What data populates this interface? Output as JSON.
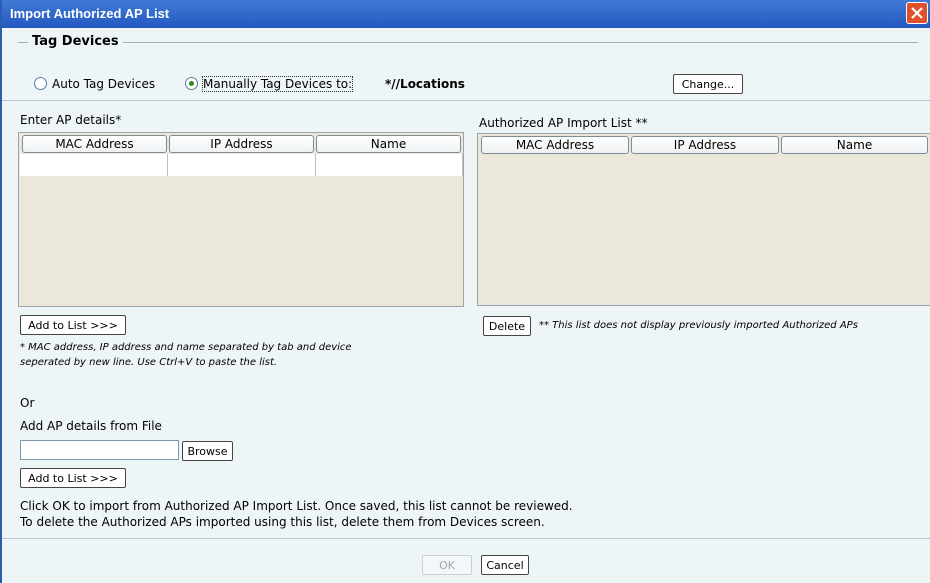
{
  "window": {
    "title": "Import Authorized AP List"
  },
  "tag_devices": {
    "legend": "Tag Devices",
    "auto_label": "Auto Tag Devices",
    "manual_label": "Manually Tag Devices to:",
    "location": "*//Locations",
    "change_label": "Change..."
  },
  "enter_details": {
    "label": "Enter AP details*",
    "columns": [
      "MAC Address",
      "IP Address",
      "Name"
    ],
    "add_label": "Add to List >>>",
    "note": "* MAC address, IP address and name separated by tab and device seperated by new line. Use Ctrl+V to paste the list."
  },
  "import_list": {
    "label": "Authorized AP Import List **",
    "columns": [
      "MAC Address",
      "IP Address",
      "Name"
    ],
    "delete_label": "Delete",
    "note": "** This list does not display previously imported Authorized APs"
  },
  "or_label": "Or",
  "file": {
    "label": "Add AP details from File",
    "value": "",
    "browse_label": "Browse",
    "add_label": "Add to List >>>"
  },
  "info": {
    "line1": "Click OK to import from Authorized AP Import List. Once saved, this list cannot be reviewed.",
    "line2": "To delete the Authorized APs imported using this list, delete them from Devices screen."
  },
  "footer": {
    "ok_label": "OK",
    "cancel_label": "Cancel"
  },
  "colors": {
    "titlebar": "#2f68cc",
    "dialog_bg": "#eef5f7",
    "grid_bg": "#ebe7d9"
  }
}
